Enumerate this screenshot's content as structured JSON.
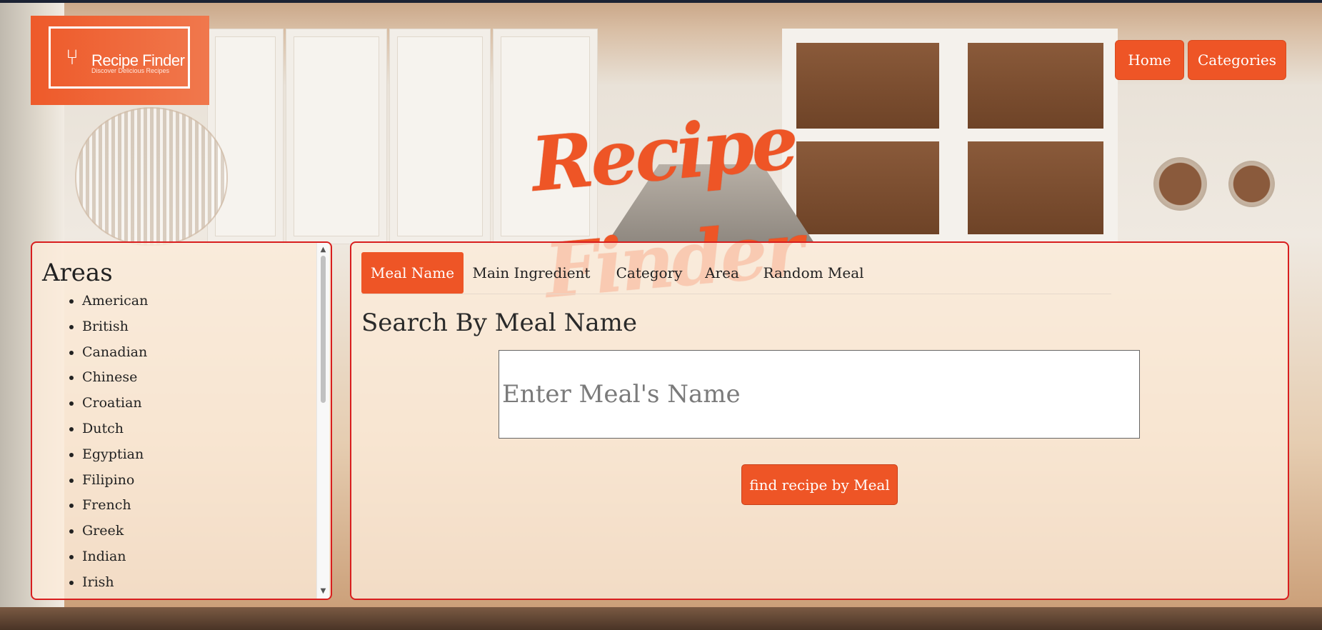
{
  "brand": {
    "logo_title": "Recipe Finder",
    "logo_subtitle": "Discover Delicious Recipes",
    "logo_icon": "fork-spoon-icon",
    "hero_title": "Recipe Finder",
    "accent_color": "#ee5526",
    "panel_border_color": "#d81e1e"
  },
  "nav": {
    "home_label": "Home",
    "categories_label": "Categories"
  },
  "areas": {
    "heading": "Areas",
    "items": [
      "American",
      "British",
      "Canadian",
      "Chinese",
      "Croatian",
      "Dutch",
      "Egyptian",
      "Filipino",
      "French",
      "Greek",
      "Indian",
      "Irish"
    ]
  },
  "search": {
    "tabs": [
      "Meal Name",
      "Main Ingredient",
      "Category",
      "Area",
      "Random Meal"
    ],
    "active_tab": "Meal Name",
    "heading": "Search By Meal Name",
    "input_value": "",
    "input_placeholder": "Enter Meal's Name",
    "button_label": "find recipe by Meal"
  }
}
